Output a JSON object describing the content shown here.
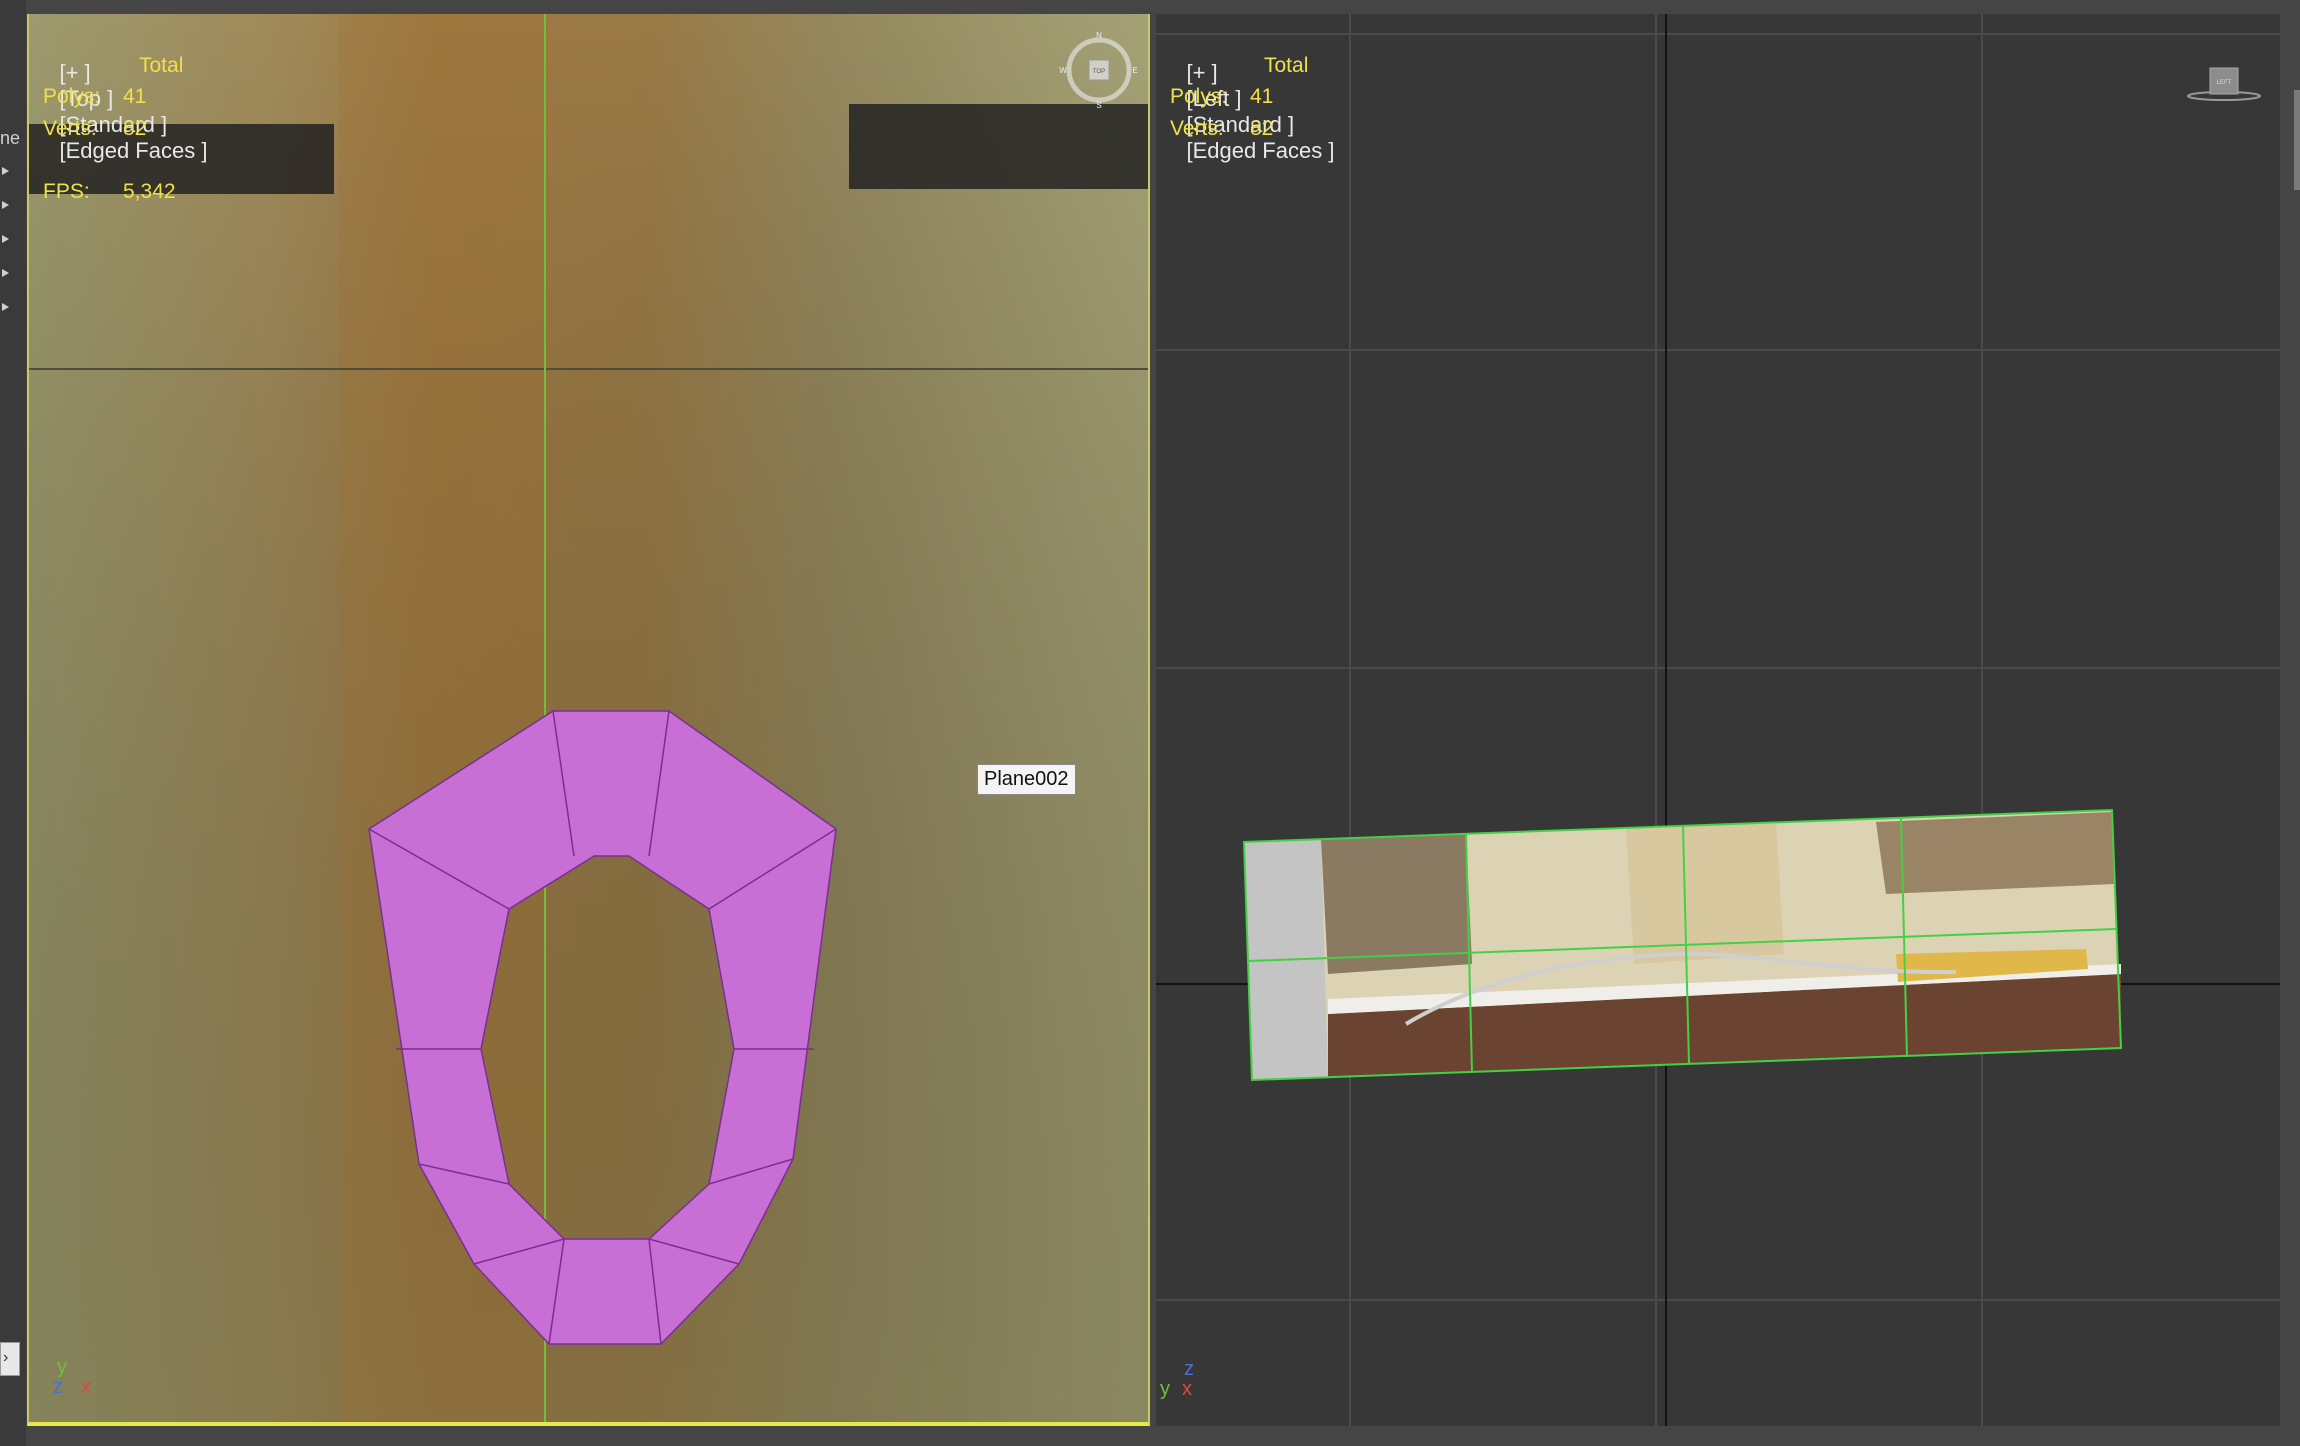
{
  "side_panel": {
    "partial_label": "ne"
  },
  "viewports": {
    "top": {
      "label_plus": "[+ ]",
      "label_view": "[Top ]",
      "label_shading": "[Standard ]",
      "label_edges": "[Edged Faces ]",
      "stats": {
        "header": "Total",
        "polys_label": "Polys:",
        "polys_value": "41",
        "verts_label": "Verts:",
        "verts_value": "82",
        "fps_label": "FPS:",
        "fps_value": "5,342"
      },
      "object_tooltip": "Plane002",
      "gizmo_axes": {
        "y": "y",
        "z": "z",
        "x": "x"
      },
      "viewcube_label": "TOP",
      "compass": {
        "n": "N",
        "s": "S",
        "e": "E",
        "w": "W"
      },
      "mesh_color": "#c86fd6"
    },
    "left": {
      "label_plus": "[+ ]",
      "label_view": "[Left ]",
      "label_shading": "[Standard ]",
      "label_edges": "[Edged Faces ]",
      "stats": {
        "header": "Total",
        "polys_label": "Polys:",
        "polys_value": "41",
        "verts_label": "Verts:",
        "verts_value": "82"
      },
      "gizmo_axes": {
        "y": "y",
        "z": "z",
        "x": "x"
      },
      "viewcube_label": "LEFT"
    }
  },
  "colors": {
    "stats_text": "#f0e04a",
    "active_viewport_border": "#e6e84a",
    "viewport_bg": "#373737",
    "grid_line": "#4a4a4a",
    "mesh_fill": "#c86fd6",
    "mesh_edge": "#7a2f90",
    "plane_edge": "#44d044"
  }
}
